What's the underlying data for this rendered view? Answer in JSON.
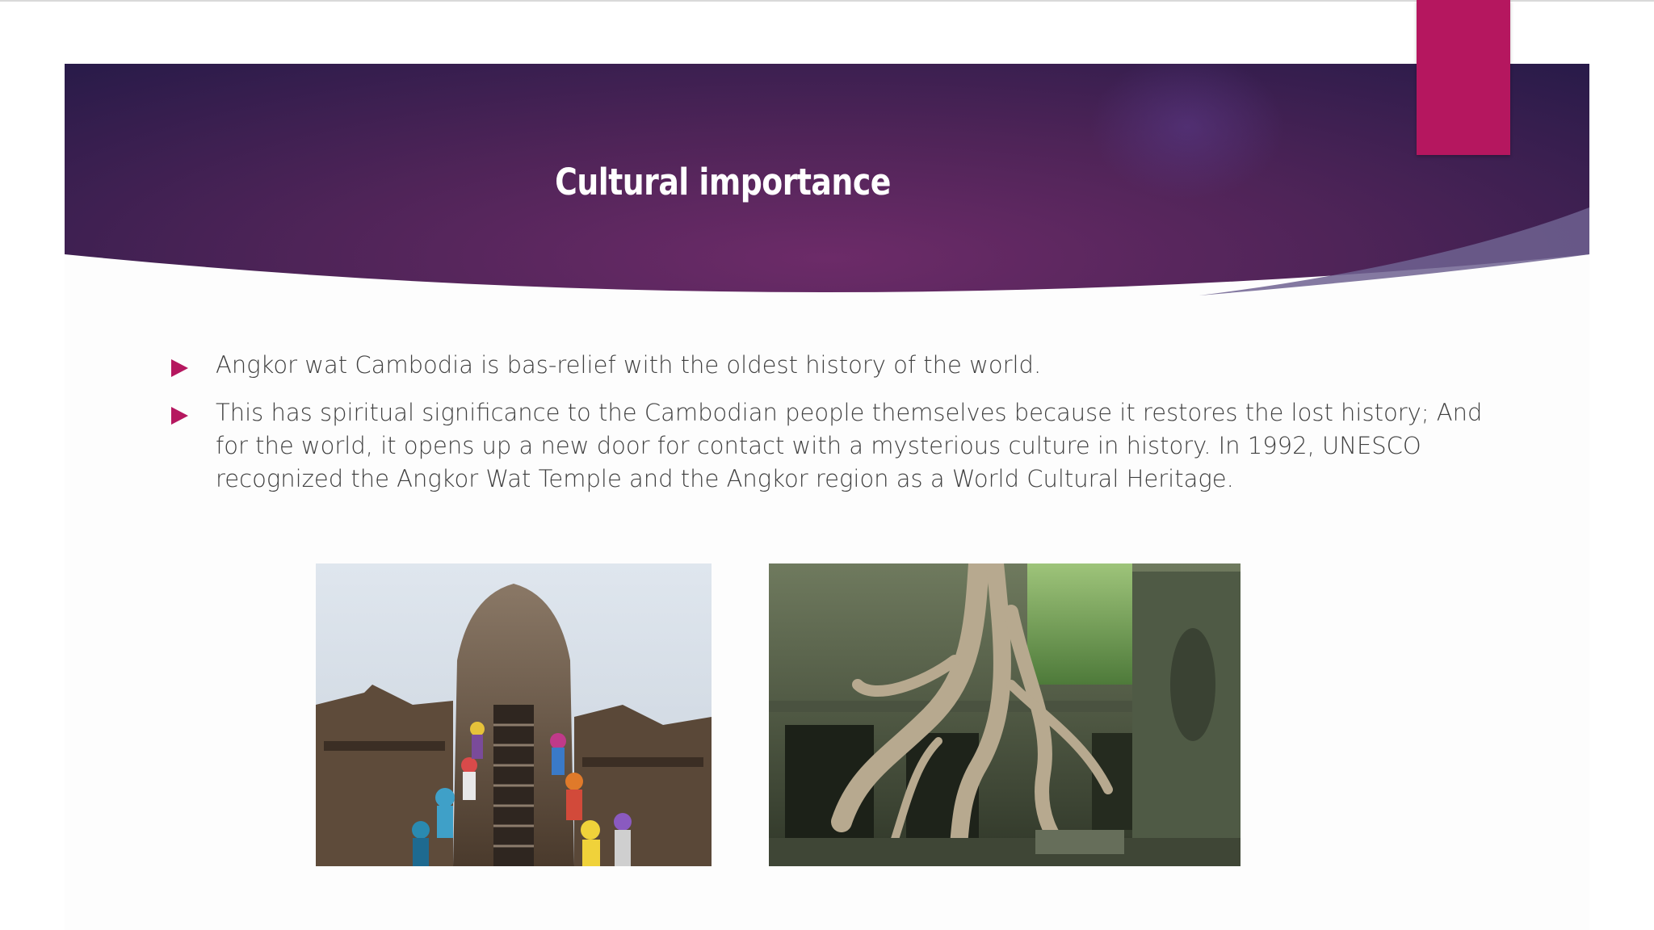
{
  "slide": {
    "title": "Cultural importance",
    "bullets": [
      "Angkor wat Cambodia is bas-relief with the oldest history of the world.",
      "This has spiritual significance to the Cambodian people themselves because it restores the lost history; And for the world, it opens up a new door for contact with a mysterious culture in history. In 1992, UNESCO recognized the Angkor Wat Temple and the Angkor region as a World Cultural Heritage."
    ],
    "images": [
      {
        "name": "tourists-climbing-temple-stairs-photo"
      },
      {
        "name": "tree-roots-over-temple-ruins-photo"
      }
    ]
  },
  "theme": {
    "banner_dark": "#2a1c4a",
    "banner_mid": "#6a2a68",
    "accent": "#b5175f",
    "text": "#404040",
    "title_text": "#ffffff"
  },
  "icons": {
    "bullet": "triangle-right-icon"
  }
}
